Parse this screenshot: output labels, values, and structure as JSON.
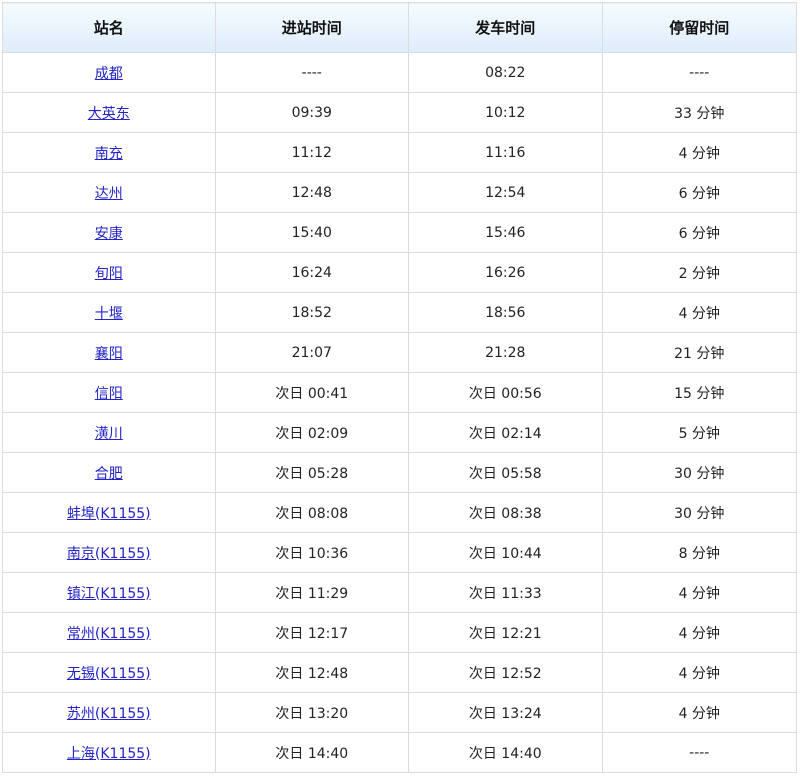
{
  "headers": {
    "station": "站名",
    "arrival": "进站时间",
    "departure": "发车时间",
    "stop": "停留时间"
  },
  "rows": [
    {
      "station": "成都",
      "arrival": "----",
      "departure": "08:22",
      "stop": "----"
    },
    {
      "station": "大英东",
      "arrival": "09:39",
      "departure": "10:12",
      "stop": "33 分钟"
    },
    {
      "station": "南充",
      "arrival": "11:12",
      "departure": "11:16",
      "stop": "4 分钟"
    },
    {
      "station": "达州",
      "arrival": "12:48",
      "departure": "12:54",
      "stop": "6 分钟"
    },
    {
      "station": "安康",
      "arrival": "15:40",
      "departure": "15:46",
      "stop": "6 分钟"
    },
    {
      "station": "旬阳",
      "arrival": "16:24",
      "departure": "16:26",
      "stop": "2 分钟"
    },
    {
      "station": "十堰",
      "arrival": "18:52",
      "departure": "18:56",
      "stop": "4 分钟"
    },
    {
      "station": "襄阳",
      "arrival": "21:07",
      "departure": "21:28",
      "stop": "21 分钟"
    },
    {
      "station": "信阳",
      "arrival": "次日 00:41",
      "departure": "次日 00:56",
      "stop": "15 分钟"
    },
    {
      "station": "潢川",
      "arrival": "次日 02:09",
      "departure": "次日 02:14",
      "stop": "5 分钟"
    },
    {
      "station": "合肥",
      "arrival": "次日 05:28",
      "departure": "次日 05:58",
      "stop": "30 分钟"
    },
    {
      "station": "蚌埠(K1155)",
      "arrival": "次日 08:08",
      "departure": "次日 08:38",
      "stop": "30 分钟"
    },
    {
      "station": "南京(K1155)",
      "arrival": "次日 10:36",
      "departure": "次日 10:44",
      "stop": "8 分钟"
    },
    {
      "station": "镇江(K1155)",
      "arrival": "次日 11:29",
      "departure": "次日 11:33",
      "stop": "4 分钟"
    },
    {
      "station": "常州(K1155)",
      "arrival": "次日 12:17",
      "departure": "次日 12:21",
      "stop": "4 分钟"
    },
    {
      "station": "无锡(K1155)",
      "arrival": "次日 12:48",
      "departure": "次日 12:52",
      "stop": "4 分钟"
    },
    {
      "station": "苏州(K1155)",
      "arrival": "次日 13:20",
      "departure": "次日 13:24",
      "stop": "4 分钟"
    },
    {
      "station": "上海(K1155)",
      "arrival": "次日 14:40",
      "departure": "次日 14:40",
      "stop": "----"
    }
  ],
  "colors": {
    "link": "#2323c8",
    "header_bg_top": "#f6fbff",
    "header_bg_bottom": "#ddedfb",
    "border": "#dcdcdc"
  }
}
